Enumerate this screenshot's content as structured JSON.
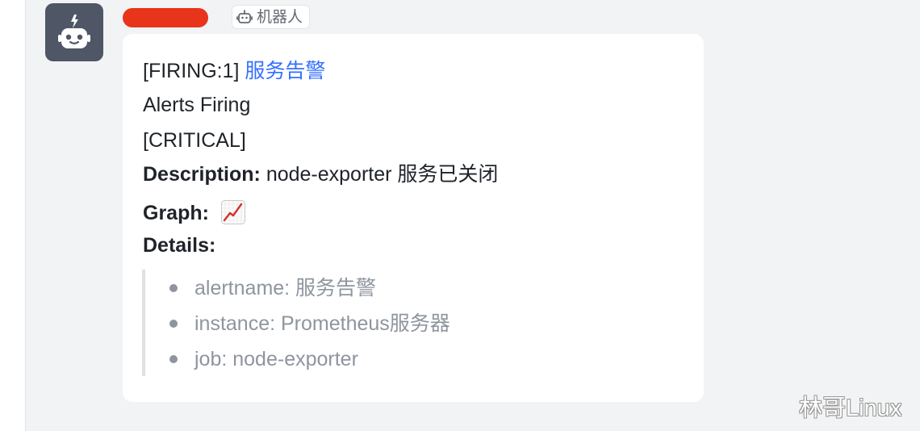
{
  "sender": {
    "name_redacted": true,
    "redaction_color": "#e8341a",
    "avatar_icon": "robot-icon",
    "tag": {
      "icon": "robot-icon",
      "label": "机器人"
    }
  },
  "message": {
    "status_prefix": "[FIRING:1]",
    "alert_title_link": "服务告警",
    "heading": "Alerts Firing",
    "severity": "[CRITICAL]",
    "description_label": "Description:",
    "description_value": "node-exporter 服务已关闭",
    "graph_label": "Graph:",
    "graph_icon": "chart-increasing-icon",
    "details_label": "Details:",
    "details": [
      {
        "text": "alertname: 服务告警"
      },
      {
        "text": "instance: Prometheus服务器"
      },
      {
        "text": "job: node-exporter"
      }
    ]
  },
  "watermark": "林哥Linux",
  "colors": {
    "link": "#3370ff",
    "avatar_bg": "#4f5665",
    "muted_text": "#8f959e"
  }
}
